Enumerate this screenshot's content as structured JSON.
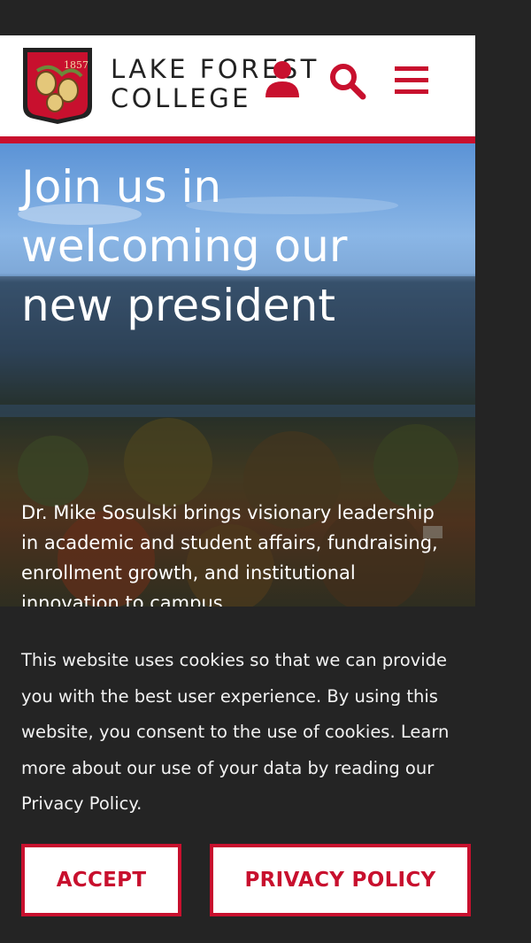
{
  "header": {
    "logo_line1": "LAKE FOREST",
    "logo_line2": "COLLEGE",
    "crest_year": "1857",
    "icons": [
      "person-icon",
      "search-icon",
      "menu-icon"
    ]
  },
  "hero": {
    "headline": "Join us in welcoming our new president",
    "description": "Dr. Mike Sosulski brings visionary leadership in academic and student affairs, fundraising, enrollment growth, and institutional innovation to campus."
  },
  "cookie_banner": {
    "text": "This website uses cookies so that we can provide you with the best user experience. By using this website, you consent to the use of cookies. Learn more about our use of your data by reading our Privacy Policy.",
    "accept_label": "ACCEPT",
    "privacy_label": "PRIVACY POLICY"
  },
  "colors": {
    "brand_red": "#c8102e",
    "banner_bg": "#242424"
  }
}
